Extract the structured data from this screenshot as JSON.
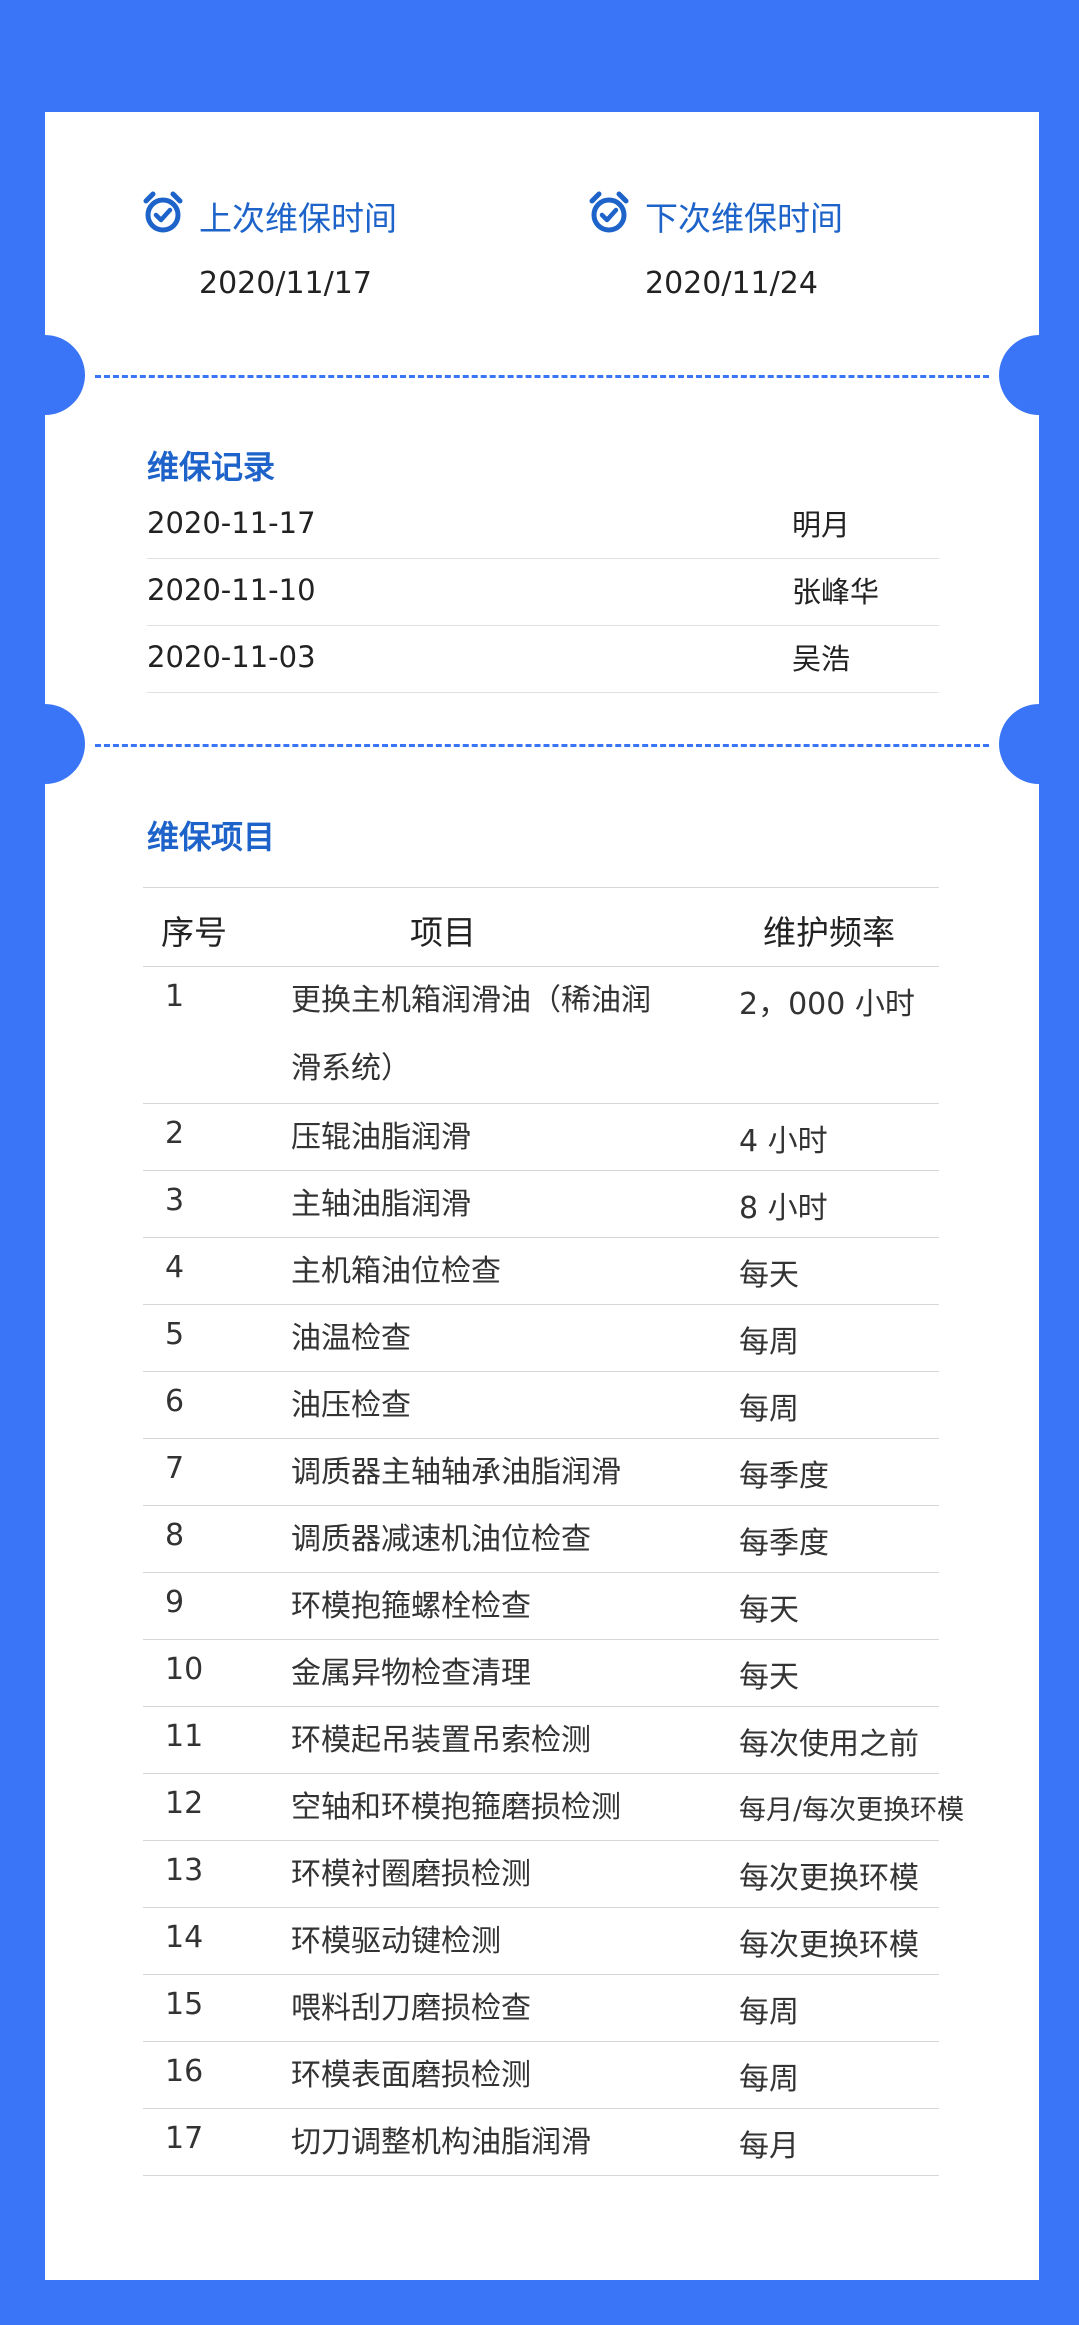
{
  "colors": {
    "background": "#3a74f7",
    "accent": "#1d63c9",
    "card": "#ffffff"
  },
  "last_maintenance": {
    "icon": "alarm-clock-icon",
    "label": "上次维保时间",
    "value": "2020/11/17"
  },
  "next_maintenance": {
    "icon": "alarm-clock-icon",
    "label": "下次维保时间",
    "value": "2020/11/24"
  },
  "records": {
    "title": "维保记录",
    "rows": [
      {
        "date": "2020-11-17",
        "person": "明月"
      },
      {
        "date": "2020-11-10",
        "person": "张峰华"
      },
      {
        "date": "2020-11-03",
        "person": "吴浩"
      }
    ]
  },
  "items": {
    "title": "维保项目",
    "headers": {
      "no": "序号",
      "item": "项目",
      "frequency": "维护频率"
    },
    "rows": [
      {
        "no": "1",
        "item": "更换主机箱润滑油（稀油润滑系统）",
        "frequency": "2，000 小时"
      },
      {
        "no": "2",
        "item": "压辊油脂润滑",
        "frequency": "4 小时"
      },
      {
        "no": "3",
        "item": "主轴油脂润滑",
        "frequency": "8 小时"
      },
      {
        "no": "4",
        "item": "主机箱油位检查",
        "frequency": "每天"
      },
      {
        "no": "5",
        "item": "油温检查",
        "frequency": "每周"
      },
      {
        "no": "6",
        "item": "油压检查",
        "frequency": "每周"
      },
      {
        "no": "7",
        "item": "调质器主轴轴承油脂润滑",
        "frequency": "每季度"
      },
      {
        "no": "8",
        "item": "调质器减速机油位检查",
        "frequency": "每季度"
      },
      {
        "no": "9",
        "item": "环模抱箍螺栓检查",
        "frequency": "每天"
      },
      {
        "no": "10",
        "item": "金属异物检查清理",
        "frequency": "每天"
      },
      {
        "no": "11",
        "item": "环模起吊装置吊索检测",
        "frequency": "每次使用之前"
      },
      {
        "no": "12",
        "item": "空轴和环模抱箍磨损检测",
        "frequency": "每月/每次更换环模"
      },
      {
        "no": "13",
        "item": "环模衬圈磨损检测",
        "frequency": "每次更换环模"
      },
      {
        "no": "14",
        "item": "环模驱动键检测",
        "frequency": "每次更换环模"
      },
      {
        "no": "15",
        "item": "喂料刮刀磨损检查",
        "frequency": "每周"
      },
      {
        "no": "16",
        "item": "环模表面磨损检测",
        "frequency": "每周"
      },
      {
        "no": "17",
        "item": "切刀调整机构油脂润滑",
        "frequency": "每月"
      }
    ]
  }
}
